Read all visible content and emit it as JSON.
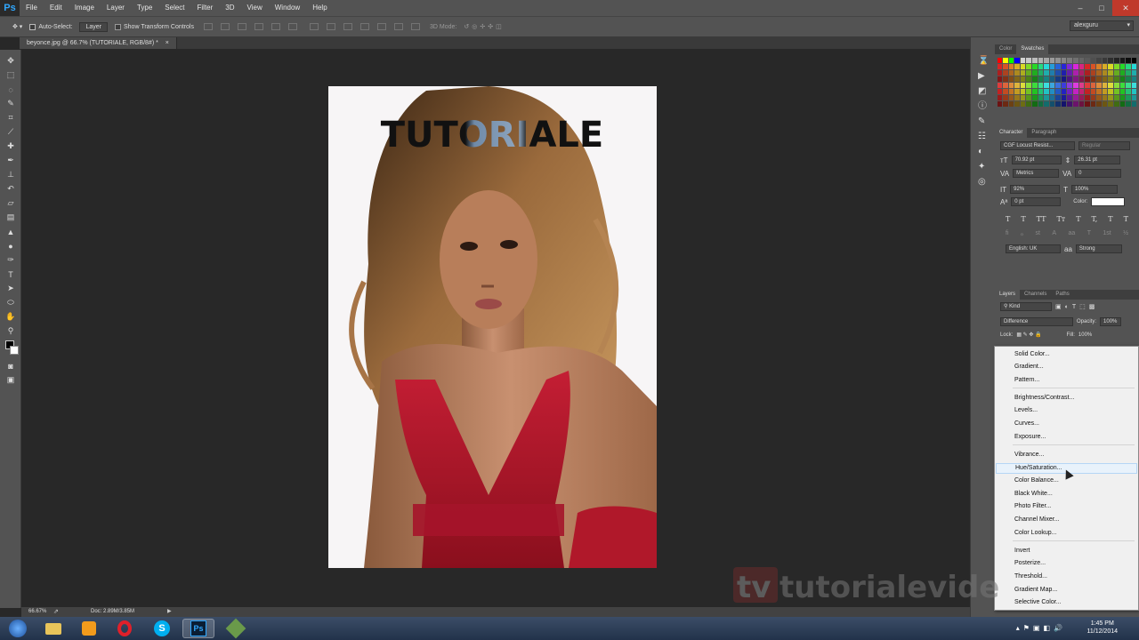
{
  "app": {
    "logo": "Ps"
  },
  "menu": [
    "File",
    "Edit",
    "Image",
    "Layer",
    "Type",
    "Select",
    "Filter",
    "3D",
    "View",
    "Window",
    "Help"
  ],
  "window_controls": {
    "minimize": "–",
    "maximize": "□",
    "close": "✕"
  },
  "options": {
    "auto_select_label": "Auto-Select:",
    "auto_select_target": "Layer",
    "show_transform": "Show Transform Controls",
    "mode_3d": "3D Mode:",
    "workspace": "alexguru"
  },
  "document": {
    "tab_title": "beyonce.jpg @ 66.7% (TUTORIALE, RGB/8#) *",
    "tab_close": "×",
    "overlay_text": "TUTORIALE"
  },
  "status": {
    "zoom": "66.67%",
    "doc_size": "Doc: 2.89M/3.85M"
  },
  "panels": {
    "swatches_tabs": [
      "Color",
      "Swatches"
    ],
    "character_tabs": [
      "Character",
      "Paragraph"
    ],
    "font_family": "CGF Locust Resist...",
    "font_style": "Regular",
    "font_size": "70.92 pt",
    "leading": "26.31 pt",
    "kerning": "Metrics",
    "tracking": "0",
    "vscale": "92%",
    "hscale": "100%",
    "baseline": "0 pt",
    "color_label": "Color:",
    "type_buttons": [
      "T",
      "T",
      "TT",
      "Tт",
      "T",
      "T,",
      "T",
      "T"
    ],
    "ot_buttons": [
      "fi",
      "ℴ",
      "st",
      "A",
      "aa",
      "T",
      "1st",
      "½"
    ],
    "language": "English: UK",
    "antialias_icon": "aa",
    "antialias": "Strong",
    "layers_tabs": [
      "Layers",
      "Channels",
      "Paths"
    ],
    "kind": "Kind",
    "blend_mode": "Difference",
    "opacity_label": "Opacity:",
    "opacity": "100%",
    "lock_label": "Lock:",
    "fill_label": "Fill:",
    "fill": "100%"
  },
  "adjustment_menu": {
    "items": [
      "Solid Color...",
      "Gradient...",
      "Pattern...",
      "Brightness/Contrast...",
      "Levels...",
      "Curves...",
      "Exposure...",
      "Vibrance...",
      "Hue/Saturation...",
      "Color Balance...",
      "Black  White...",
      "Photo Filter...",
      "Channel Mixer...",
      "Color Lookup...",
      "Invert",
      "Posterize...",
      "Threshold...",
      "Gradient Map...",
      "Selective Color..."
    ],
    "highlighted": "Hue/Saturation..."
  },
  "watermark": {
    "text": "tvtutorialevideo"
  },
  "taskbar": {
    "time": "1:45 PM",
    "date": "11/12/2014"
  },
  "colors": {
    "ui_bg": "#535353",
    "canvas_bg": "#282828",
    "dress_red": "#b0182a",
    "accent": "#31a8ff"
  }
}
